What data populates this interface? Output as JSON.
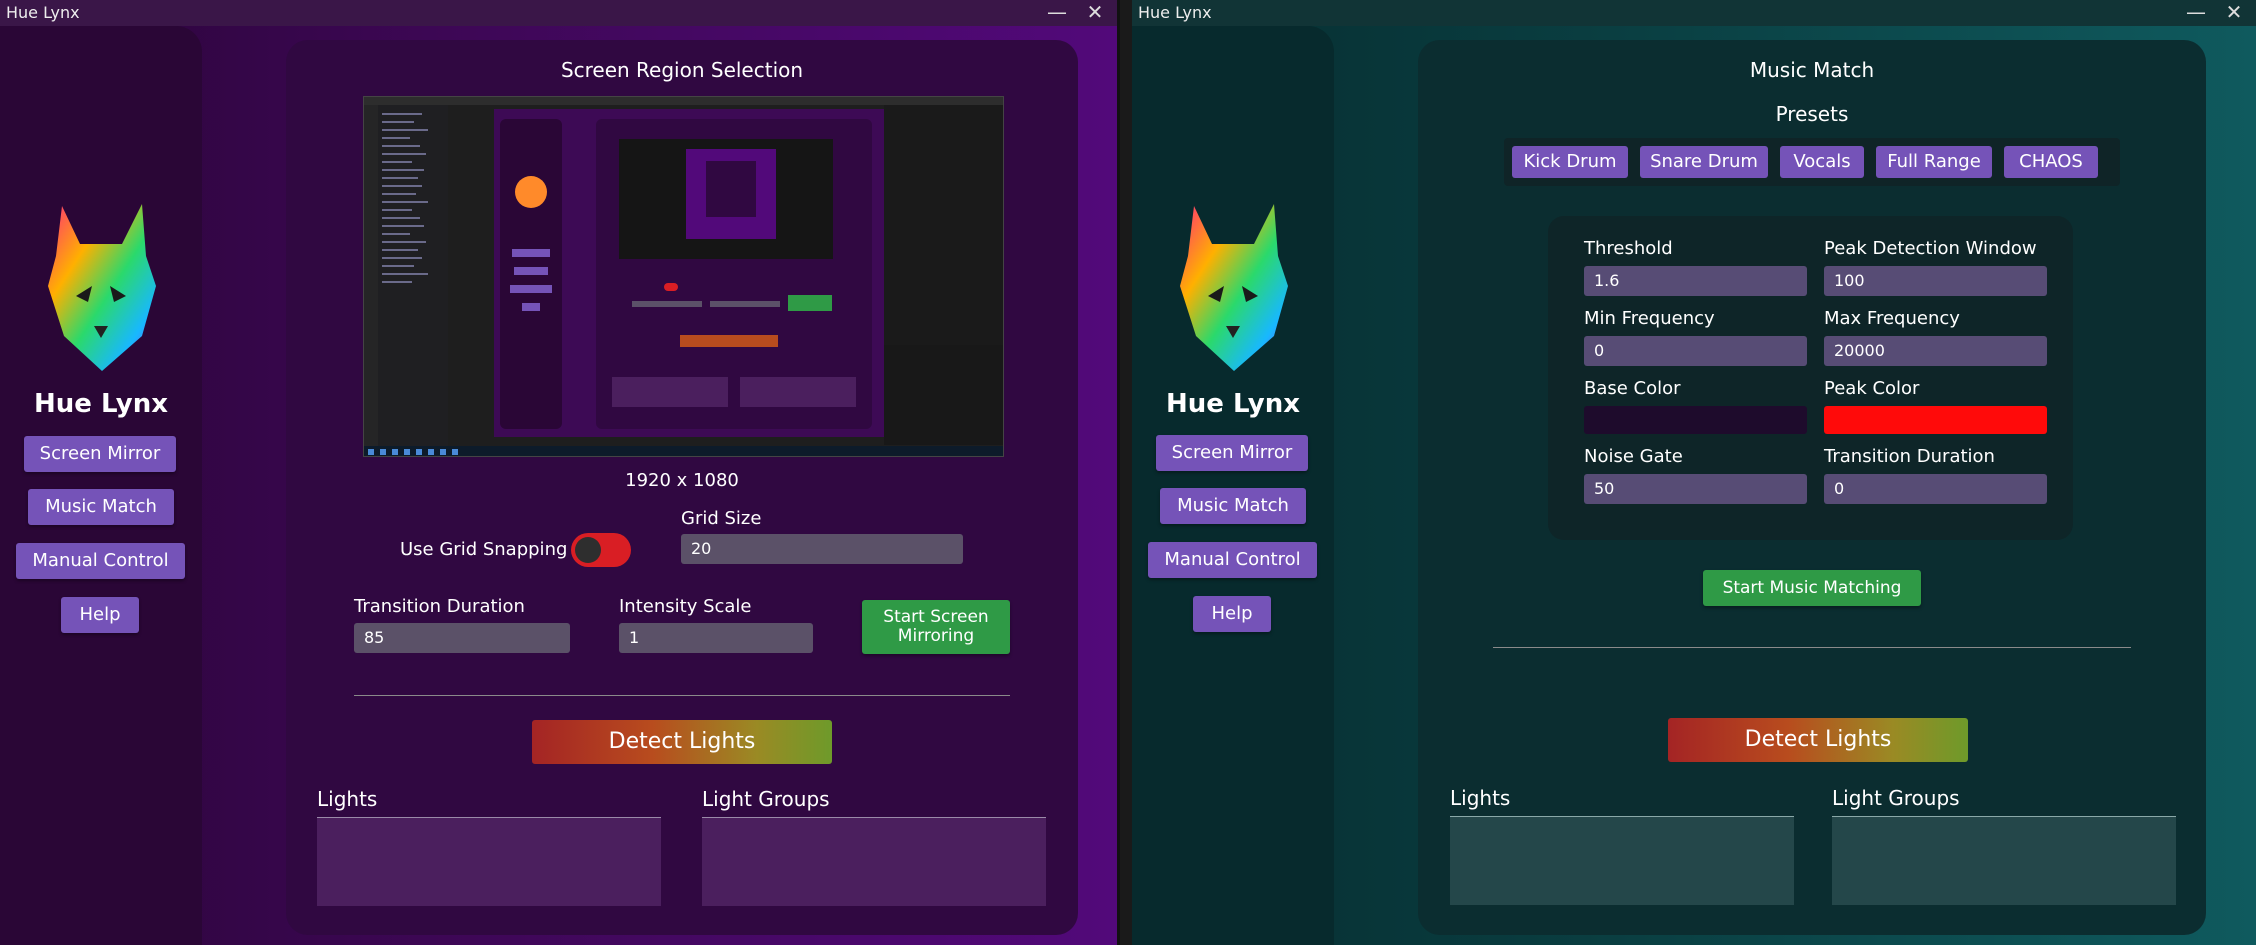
{
  "left": {
    "title": "Hue Lynx",
    "app_name": "Hue Lynx",
    "nav": {
      "screen_mirror": "Screen Mirror",
      "music_match": "Music Match",
      "manual_control": "Manual Control",
      "help": "Help"
    },
    "panel_title": "Screen Region Selection",
    "resolution": "1920 x 1080",
    "grid_snapping_label": "Use Grid Snapping",
    "grid_snapping_on": true,
    "grid_size_label": "Grid Size",
    "grid_size_value": "20",
    "transition_label": "Transition Duration",
    "transition_value": "85",
    "intensity_label": "Intensity Scale",
    "intensity_value": "1",
    "start_label": "Start Screen Mirroring",
    "detect_label": "Detect Lights",
    "lights_label": "Lights",
    "groups_label": "Light Groups"
  },
  "right": {
    "title": "Hue Lynx",
    "app_name": "Hue Lynx",
    "nav": {
      "screen_mirror": "Screen Mirror",
      "music_match": "Music Match",
      "manual_control": "Manual Control",
      "help": "Help"
    },
    "panel_title": "Music Match",
    "presets_label": "Presets",
    "presets": [
      "Kick Drum",
      "Snare Drum",
      "Vocals",
      "Full Range",
      "CHAOS"
    ],
    "threshold_label": "Threshold",
    "threshold_value": "1.6",
    "peak_window_label": "Peak Detection Window",
    "peak_window_value": "100",
    "min_freq_label": "Min Frequency",
    "min_freq_value": "0",
    "max_freq_label": "Max Frequency",
    "max_freq_value": "20000",
    "base_color_label": "Base Color",
    "base_color": "#1e0b2c",
    "peak_color_label": "Peak Color",
    "peak_color": "#ff0a0a",
    "noise_gate_label": "Noise Gate",
    "noise_gate_value": "50",
    "transition_label": "Transition Duration",
    "transition_value": "0",
    "start_label": "Start Music Matching",
    "detect_label": "Detect Lights",
    "lights_label": "Lights",
    "groups_label": "Light Groups"
  },
  "window_controls": {
    "minimize": "—",
    "close": "✕"
  },
  "icons": {
    "logo": "lynx-logo-icon"
  }
}
